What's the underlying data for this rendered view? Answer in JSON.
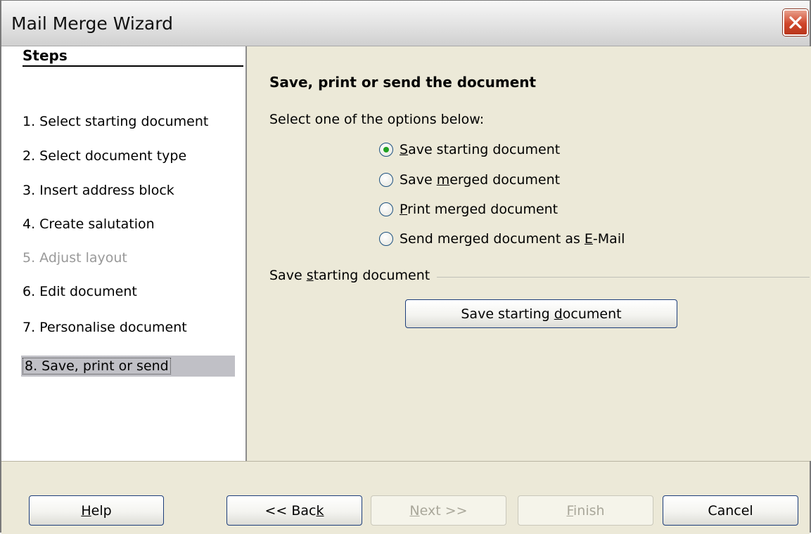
{
  "window": {
    "title": "Mail Merge Wizard"
  },
  "steps": {
    "header": "Steps",
    "items": [
      {
        "label": "1. Select starting document"
      },
      {
        "label": "2. Select document type"
      },
      {
        "label": "3. Insert address block"
      },
      {
        "label": "4. Create salutation"
      },
      {
        "label": "5. Adjust layout"
      },
      {
        "label": "6. Edit document"
      },
      {
        "label": "7. Personalise document"
      },
      {
        "label": "8. Save, print or send"
      }
    ]
  },
  "content": {
    "title": "Save, print or send the document",
    "instruction": "Select one of the options below:",
    "options": [
      {
        "pre": "",
        "key": "S",
        "post": "ave starting document",
        "checked": true
      },
      {
        "pre": "Save ",
        "key": "m",
        "post": "erged document",
        "checked": false
      },
      {
        "pre": "",
        "key": "P",
        "post": "rint merged document",
        "checked": false
      },
      {
        "pre": "Send merged document as ",
        "key": "E",
        "post": "-Mail",
        "checked": false
      }
    ],
    "section": {
      "pre": "Save ",
      "key": "s",
      "post": "tarting document"
    },
    "save_button": {
      "pre": "Save starting ",
      "key": "d",
      "post": "ocument"
    }
  },
  "footer": {
    "help": {
      "pre": "",
      "key": "H",
      "post": "elp"
    },
    "back": {
      "pre": "<< Bac",
      "key": "k",
      "post": ""
    },
    "next": {
      "pre": "",
      "key": "N",
      "post": "ext >>"
    },
    "finish": {
      "pre": "",
      "key": "F",
      "post": "inish"
    },
    "cancel": {
      "label": "Cancel"
    }
  },
  "colors": {
    "accent": "#1c3d7a",
    "dialog_bg": "#ECE9D8",
    "selected_step_bg": "#c0c0c6",
    "radio_dot": "#21a121",
    "close_button": "#d0462a"
  }
}
